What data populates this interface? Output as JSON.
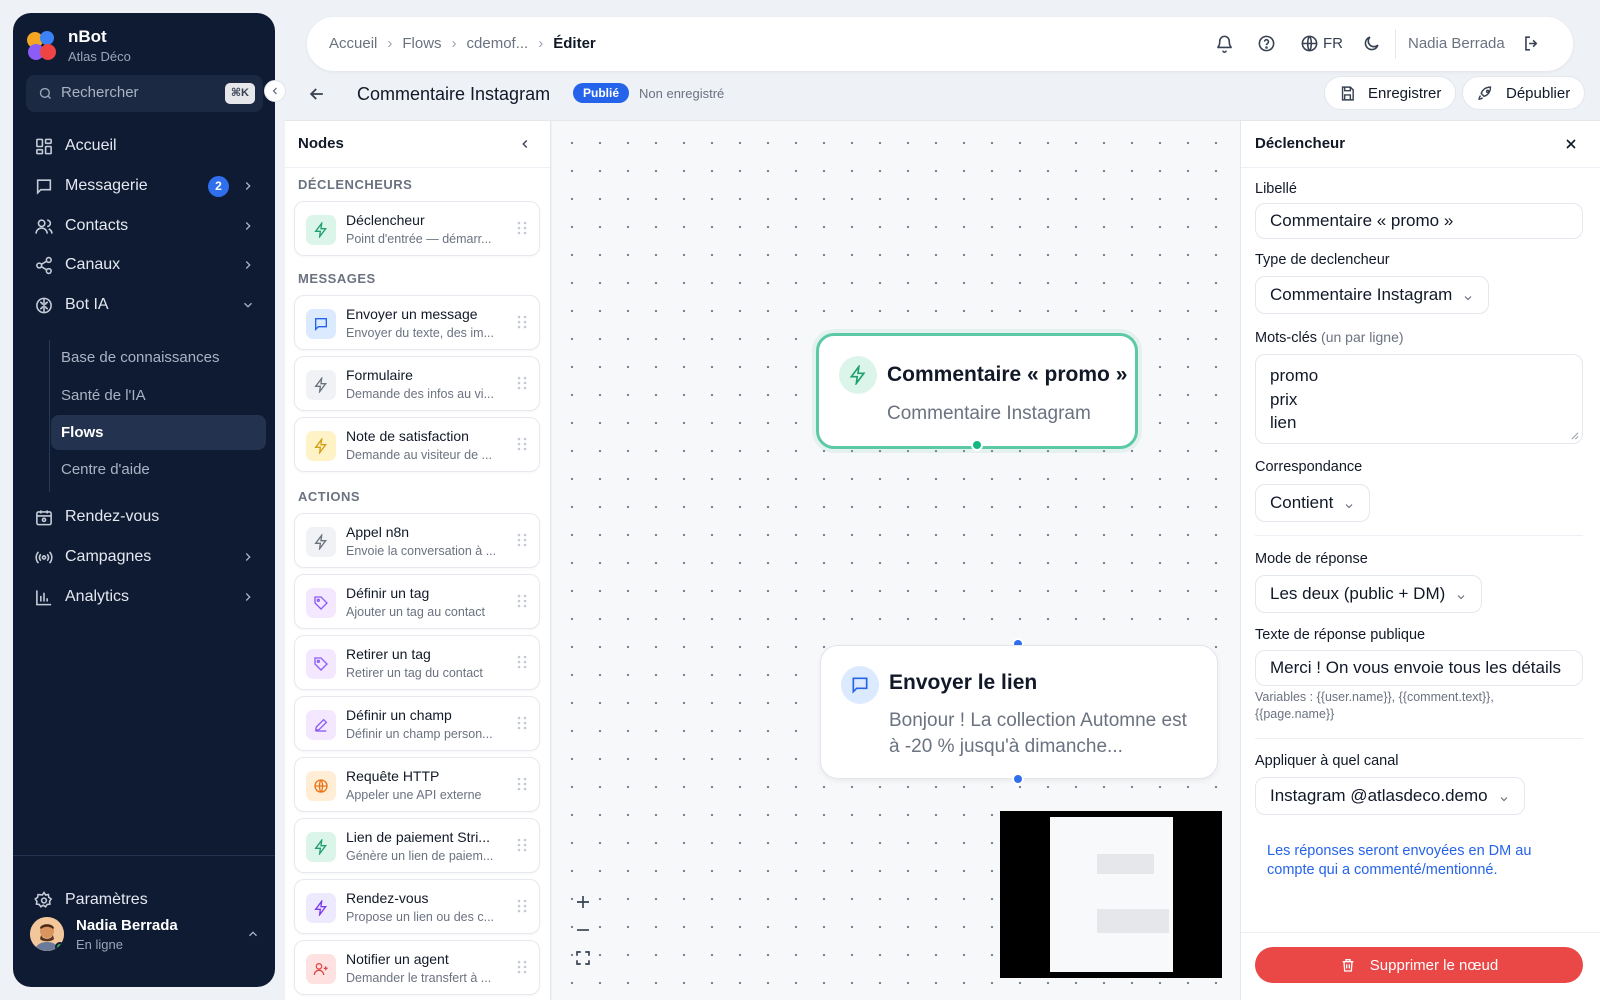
{
  "app": {
    "name": "nBot",
    "workspace": "Atlas Déco"
  },
  "search": {
    "placeholder": "Rechercher",
    "shortcut": "⌘K"
  },
  "nav": {
    "home": "Accueil",
    "messaging": "Messagerie",
    "messaging_badge": "2",
    "contacts": "Contacts",
    "channels": "Canaux",
    "bot_ai": "Bot IA",
    "bot_ai_sub": [
      "Base de connaissances",
      "Santé de l'IA",
      "Flows",
      "Centre d'aide"
    ],
    "appointments": "Rendez-vous",
    "campaigns": "Campagnes",
    "analytics": "Analytics",
    "settings": "Paramètres"
  },
  "user": {
    "name": "Nadia Berrada",
    "status": "En ligne"
  },
  "breadcrumb": [
    "Accueil",
    "Flows",
    "cdemof...",
    "Éditer"
  ],
  "topbar": {
    "language": "FR",
    "user_name": "Nadia Berrada"
  },
  "editor": {
    "flow_title": "Commentaire Instagram",
    "status_badge": "Publié",
    "save_state": "Non enregistré",
    "save_label": "Enregistrer",
    "unpublish_label": "Dépublier"
  },
  "palette": {
    "title": "Nodes",
    "sections": {
      "triggers": "DÉCLENCHEURS",
      "messages": "MESSAGES",
      "actions": "ACTIONS"
    },
    "nodes": [
      {
        "title": "Déclencheur",
        "desc": "Point d'entrée — démarr..."
      },
      {
        "title": "Envoyer un message",
        "desc": "Envoyer du texte, des im..."
      },
      {
        "title": "Formulaire",
        "desc": "Demande des infos au vi..."
      },
      {
        "title": "Note de satisfaction",
        "desc": "Demande au visiteur de ..."
      },
      {
        "title": "Appel n8n",
        "desc": "Envoie la conversation à ..."
      },
      {
        "title": "Définir un tag",
        "desc": "Ajouter un tag au contact"
      },
      {
        "title": "Retirer un tag",
        "desc": "Retirer un tag du contact"
      },
      {
        "title": "Définir un champ",
        "desc": "Définir un champ person..."
      },
      {
        "title": "Requête HTTP",
        "desc": "Appeler une API externe"
      },
      {
        "title": "Lien de paiement Stri...",
        "desc": "Génère un lien de paiem..."
      },
      {
        "title": "Rendez-vous",
        "desc": "Propose un lien ou des c..."
      },
      {
        "title": "Notifier un agent",
        "desc": "Demander le transfert à ..."
      }
    ]
  },
  "canvas": {
    "trigger_node": {
      "title": "Commentaire « promo »",
      "subtitle": "Commentaire Instagram"
    },
    "message_node": {
      "title": "Envoyer le lien",
      "text_line1": "Bonjour ! La collection Automne est",
      "text_line2": "à -20 % jusqu'à dimanche..."
    }
  },
  "properties": {
    "title": "Déclencheur",
    "label_field": "Libellé",
    "label_value": "Commentaire « promo »",
    "trigger_type_field": "Type de declencheur",
    "trigger_type_value": "Commentaire Instagram",
    "keywords_field": "Mots-clés",
    "keywords_hint": "(un par ligne)",
    "keywords": [
      "promo",
      "prix",
      "lien"
    ],
    "match_field": "Correspondance",
    "match_value": "Contient",
    "reply_mode_field": "Mode de réponse",
    "reply_mode_value": "Les deux (public + DM)",
    "public_reply_field": "Texte de réponse publique",
    "public_reply_value": "Merci ! On vous envoie tous les détails",
    "variables_line1": "Variables : {{user.name}}, {{comment.text}},",
    "variables_line2": "{{page.name}}",
    "channel_field": "Appliquer à quel canal",
    "channel_value": "Instagram @atlasdeco.demo",
    "info_text": "Les réponses seront envoyées en DM au compte qui a commenté/mentionné.",
    "delete_label": "Supprimer le nœud"
  },
  "colors": {
    "sidebar_bg": "#0f1b33",
    "accent_blue": "#2563eb",
    "trigger_green": "#5cc9a6",
    "danger_red": "#ea4747"
  }
}
